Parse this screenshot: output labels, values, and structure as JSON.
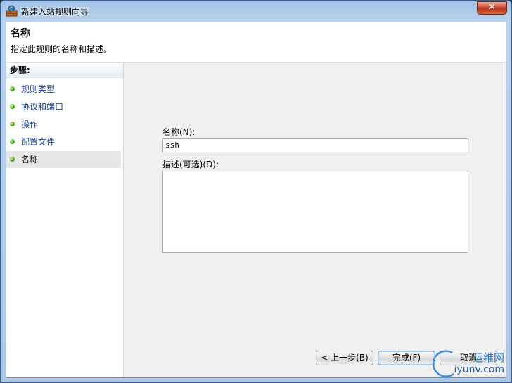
{
  "window": {
    "title": "新建入站规则向导",
    "close_label": "✕"
  },
  "header": {
    "title": "名称",
    "subtitle": "指定此规则的名称和描述。"
  },
  "steps": {
    "heading": "步骤:",
    "items": [
      {
        "label": "规则类型"
      },
      {
        "label": "协议和端口"
      },
      {
        "label": "操作"
      },
      {
        "label": "配置文件"
      },
      {
        "label": "名称",
        "current": true
      }
    ]
  },
  "form": {
    "name_label": "名称(N):",
    "name_value": "ssh",
    "desc_label": "描述(可选)(D):",
    "desc_value": ""
  },
  "buttons": {
    "back": "< 上一步(B)",
    "finish": "完成(F)",
    "cancel": "取消"
  },
  "watermark": {
    "text": "运维网",
    "url": "iyunv.com"
  },
  "colors": {
    "title_bar": "#b9d3ee",
    "link_blue": "#1a3e8c",
    "status_dot": "#3aa313",
    "close_red": "#c9462c"
  }
}
